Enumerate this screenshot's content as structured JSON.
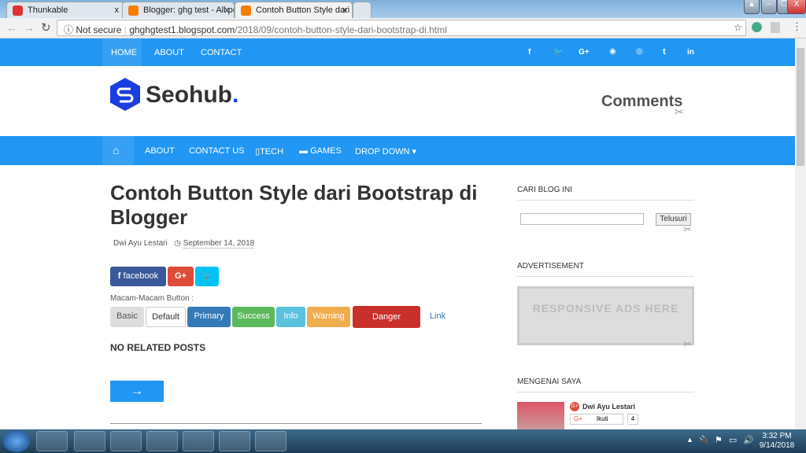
{
  "browser": {
    "tabs": [
      {
        "label": "Thunkable"
      },
      {
        "label": "Blogger: ghg test - All po"
      },
      {
        "label": "Contoh Button Style dari"
      }
    ],
    "security": "Not secure",
    "url_host": "ghghgtest1.blogspot.com",
    "url_path": "/2018/09/contoh-button-style-dari-bootstrap-di.html"
  },
  "topnav": {
    "items": [
      "HOME",
      "ABOUT",
      "CONTACT"
    ],
    "social": [
      "f",
      "t",
      "G+",
      "p",
      "ig",
      "t",
      "in"
    ]
  },
  "header": {
    "logo": "Seohub",
    "logo_dot": ".",
    "widget_title": "Comments"
  },
  "mainnav": {
    "items": [
      "ABOUT",
      "CONTACT US",
      "TECH",
      "GAMES",
      "DROP DOWN"
    ]
  },
  "post": {
    "title": "Contoh Button Style dari Bootstrap di Blogger",
    "author": "Dwi Ayu Lestari",
    "date": "September 14, 2018",
    "share": {
      "facebook": "facebook",
      "gplus": "G+",
      "twitter": "🐦"
    },
    "buttons_label": "Macam-Macam Button :",
    "buttons": [
      "Basic",
      "Default",
      "Primary",
      "Success",
      "Info",
      "Warning",
      "Danger",
      "Link"
    ],
    "related": "NO RELATED POSTS",
    "next_arrow": "→"
  },
  "sidebar": {
    "search_title": "CARI BLOG INI",
    "search_button": "Telusuri",
    "ads_title": "ADVERTISEMENT",
    "ads_text": "RESPONSIVE ADS HERE",
    "about_title": "MENGENAI SAYA",
    "profile_name": "Dwi Ayu Lestari",
    "follow": "Ikuti",
    "follow_count": "4"
  },
  "taskbar": {
    "time": "3:32 PM",
    "date": "9/14/2018"
  },
  "colors": {
    "blue": "#2196f3",
    "primary": "#337ab7",
    "success": "#5cb85c",
    "info": "#5bc0de",
    "warning": "#f0ad4e",
    "danger": "#c9302c"
  }
}
